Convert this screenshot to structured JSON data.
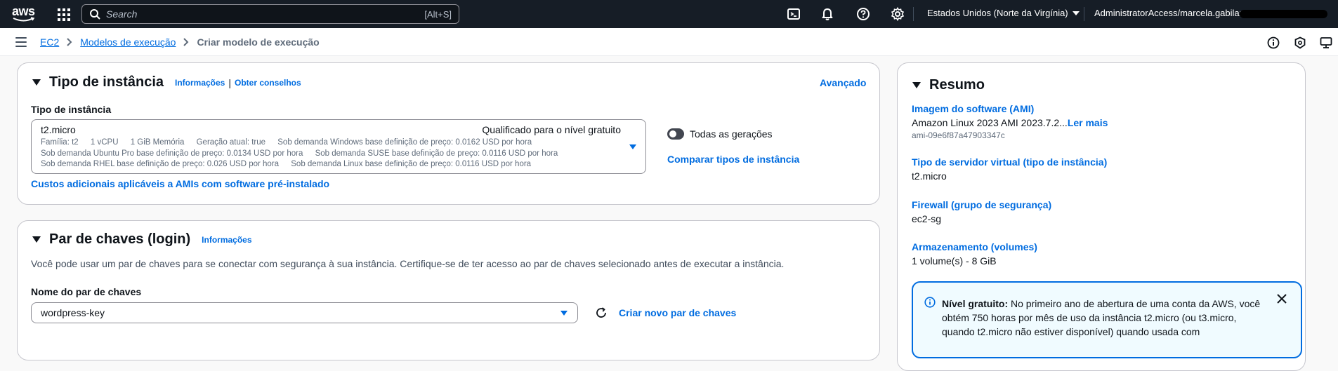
{
  "topnav": {
    "logo_text": "aws",
    "search_placeholder": "Search",
    "search_shortcut": "[Alt+S]",
    "region": "Estados Unidos (Norte da Virgínia)",
    "account": "AdministratorAccess/marcela.gabilan",
    "icons": [
      "services-grid-icon",
      "cloudshell-icon",
      "bell-icon",
      "help-icon",
      "gear-icon"
    ]
  },
  "breadcrumb": {
    "items": [
      "EC2",
      "Modelos de execução"
    ],
    "current": "Criar modelo de execução"
  },
  "instance_panel": {
    "title": "Tipo de instância",
    "info_link": "Informações",
    "divider": "|",
    "advice_link": "Obter conselhos",
    "advanced_link": "Avançado",
    "field_label": "Tipo de instância",
    "selected": {
      "name": "t2.micro",
      "tag": "Qualificado para o nível gratuito",
      "line1": [
        "Família: t2",
        "1 vCPU",
        "1 GiB Memória",
        "Geração atual: true",
        "Sob demanda Windows base definição de preço: 0.0162 USD por hora"
      ],
      "line2": [
        "Sob demanda Ubuntu Pro base definição de preço: 0.0134 USD por hora",
        "Sob demanda SUSE base definição de preço: 0.0116 USD por hora"
      ],
      "line3": [
        "Sob demanda RHEL base definição de preço: 0.026 USD por hora",
        "Sob demanda Linux base definição de preço: 0.0116 USD por hora"
      ]
    },
    "toggle_label": "Todas as gerações",
    "compare_link": "Comparar tipos de instância",
    "costs_link": "Custos adicionais aplicáveis a AMIs com software pré-instalado"
  },
  "keypair_panel": {
    "title": "Par de chaves (login)",
    "info_link": "Informações",
    "description": "Você pode usar um par de chaves para se conectar com segurança à sua instância. Certifique-se de ter acesso ao par de chaves selecionado antes de executar a instância.",
    "field_label": "Nome do par de chaves",
    "selected": "wordpress-key",
    "create_link": "Criar novo par de chaves"
  },
  "summary": {
    "title": "Resumo",
    "ami_label": "Imagem do software (AMI)",
    "ami_value": "Amazon Linux 2023 AMI 2023.7.2...",
    "ami_more": "Ler mais",
    "ami_id": "ami-09e6f87a47903347c",
    "server_label": "Tipo de servidor virtual (tipo de instância)",
    "server_value": "t2.micro",
    "firewall_label": "Firewall (grupo de segurança)",
    "firewall_value": "ec2-sg",
    "storage_label": "Armazenamento (volumes)",
    "storage_value": "1 volume(s) - 8 GiB",
    "alert_title": "Nível gratuito:",
    "alert_text": "No primeiro ano de abertura de uma conta da AWS, você obtém 750 horas por mês de uso da instância t2.micro (ou t3.micro, quando t2.micro não estiver disponível) quando usada com"
  },
  "colors": {
    "nav_bg": "#161d26",
    "link": "#006ce0",
    "alert_bg": "#f0fbff"
  }
}
